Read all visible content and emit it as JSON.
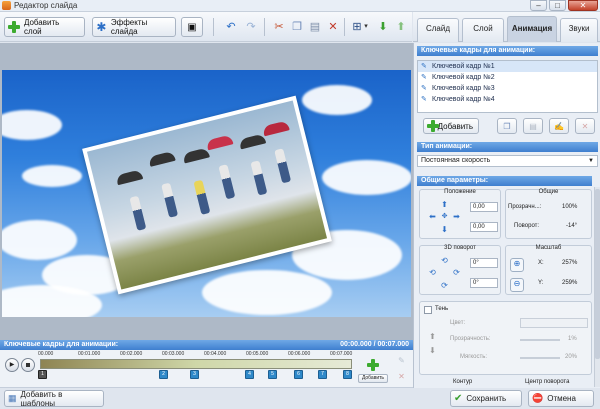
{
  "window": {
    "title": "Редактор слайда",
    "min": "–",
    "max": "□",
    "close": "✕"
  },
  "toolbar": {
    "add_layer": "Добавить слой",
    "slide_effects": "Эффекты слайда"
  },
  "tabs": [
    {
      "label": "Слайд"
    },
    {
      "label": "Слой"
    },
    {
      "label": "Анимация"
    },
    {
      "label": "Звуки"
    }
  ],
  "timeline": {
    "header": "Ключевые кадры для анимации:",
    "time": "00:00.000 / 00:07.000",
    "ticks": [
      "00.000",
      "00:01.000",
      "00:02.000",
      "00:03.000",
      "00:04.000",
      "00:05.000",
      "00:06.000",
      "00:07.000"
    ],
    "markers": [
      "1",
      "2",
      "3",
      "4",
      "5",
      "6",
      "7",
      "8"
    ],
    "add_label": "Добавить"
  },
  "panel": {
    "kf_header": "Ключевые кадры для анимации:",
    "keyframes": [
      "Ключевой кадр №1",
      "Ключевой кадр №2",
      "Ключевой кадр №3",
      "Ключевой кадр №4"
    ],
    "add_button": "Добавить",
    "anim_type_header": "Тип анимации:",
    "anim_type_value": "Постоянная скорость",
    "params_header": "Общие параметры:",
    "position_title": "Положение",
    "pos_x": "0,00",
    "pos_y": "0,00",
    "common_title": "Общие",
    "opacity_label": "Прозрачн...:",
    "opacity_value": "100%",
    "rotation_label": "Поворот:",
    "rotation_value": "-14°",
    "rot3d_title": "3D поворот",
    "rot3d_x": "0°",
    "rot3d_y": "0°",
    "scale_title": "Масштаб",
    "scale_x_label": "X:",
    "scale_x": "257%",
    "scale_y_label": "Y:",
    "scale_y": "259%",
    "shadow_label": "Тень",
    "color_label": "Цвет:",
    "transparency_label": "Прозрачность:",
    "transparency_value": "1%",
    "softness_label": "Мягкость:",
    "softness_value": "20%",
    "contour_label": "Контур",
    "rot_center_label": "Центр поворота"
  },
  "footer": {
    "add_template": "Добавить в шаблоны",
    "save": "Сохранить",
    "cancel": "Отмена"
  }
}
